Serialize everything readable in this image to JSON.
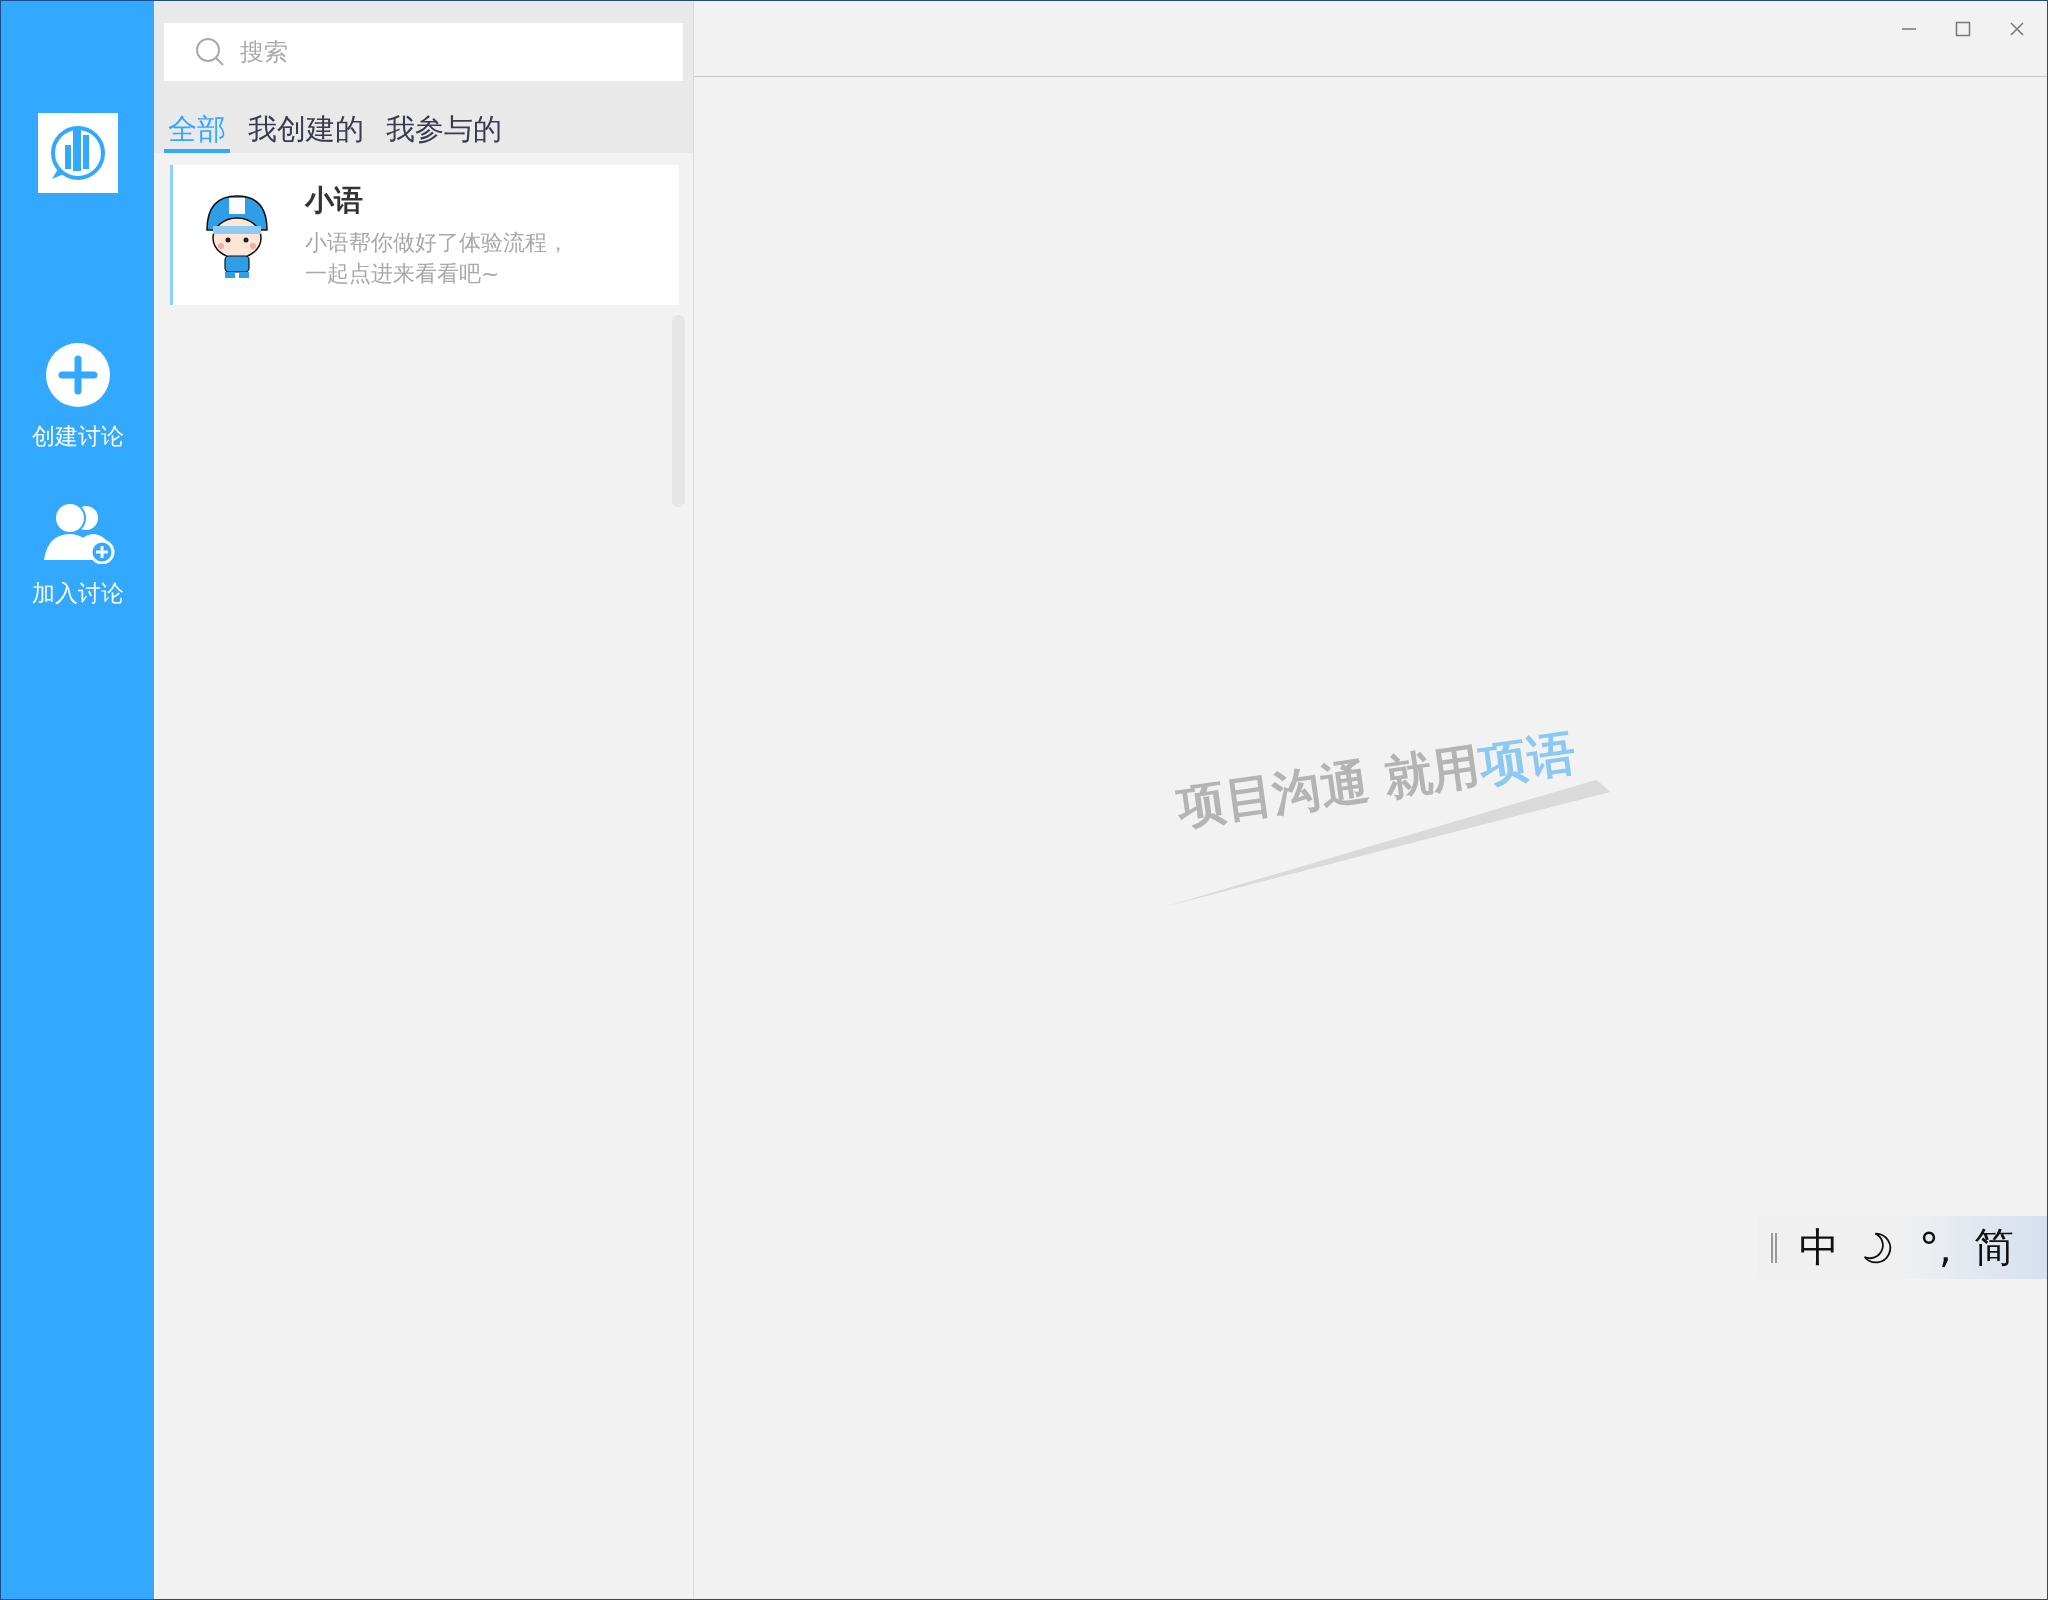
{
  "sidebar": {
    "items": [
      {
        "kind": "create",
        "label": "创建讨论"
      },
      {
        "kind": "join",
        "label": "加入讨论"
      }
    ]
  },
  "search": {
    "placeholder": "搜索"
  },
  "tabs": [
    {
      "label": "全部",
      "selected": true
    },
    {
      "label": "我创建的",
      "selected": false
    },
    {
      "label": "我参与的",
      "selected": false
    }
  ],
  "conversations": [
    {
      "name": "小语",
      "preview_lines": [
        "小语帮你做好了体验流程，",
        "一起点进来看看吧~"
      ],
      "selected": true
    }
  ],
  "slogan": {
    "lead": "项目沟通 就用",
    "brand": "项语"
  },
  "ime": {
    "mode": "中",
    "punctuation": "°,",
    "charset": "简"
  }
}
